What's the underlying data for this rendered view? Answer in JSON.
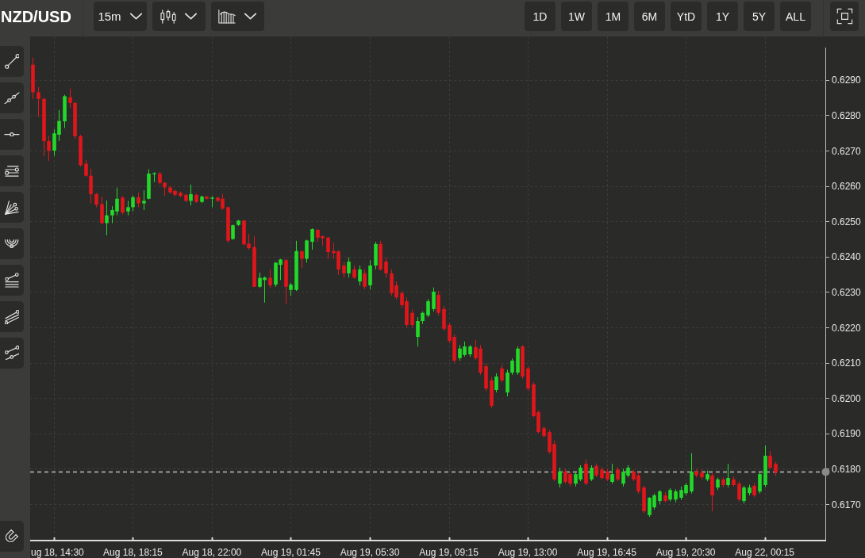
{
  "toolbar": {
    "symbol": "NZD/USD",
    "chart_controls": [
      {
        "kind": "interval",
        "label": "15m"
      },
      {
        "kind": "candles"
      },
      {
        "kind": "bars"
      }
    ],
    "ranges": [
      {
        "label": "1D",
        "selected": false
      },
      {
        "label": "1W",
        "selected": false
      },
      {
        "label": "1M",
        "selected": false
      },
      {
        "label": "6M",
        "selected": false
      },
      {
        "label": "YtD",
        "selected": false
      },
      {
        "label": "1Y",
        "selected": false
      },
      {
        "label": "5Y",
        "selected": false
      },
      {
        "label": "ALL",
        "selected": false
      }
    ]
  },
  "tools": [
    {
      "kind": "segment"
    },
    {
      "kind": "ray"
    },
    {
      "kind": "horizontal"
    },
    {
      "kind": "levels"
    },
    {
      "kind": "fan"
    },
    {
      "kind": "arcs"
    },
    {
      "kind": "angle_levels"
    },
    {
      "kind": "channel"
    },
    {
      "kind": "split"
    },
    {
      "kind": "magnet"
    }
  ],
  "chart": {
    "chart_data": {
      "type": "candlestick",
      "grid": true,
      "ylim": [
        0.61597,
        0.63023
      ],
      "yticks": [
        {
          "value": 0.629,
          "label": "0.6290"
        },
        {
          "value": 0.628,
          "label": "0.6280"
        },
        {
          "value": 0.627,
          "label": "0.6270"
        },
        {
          "value": 0.626,
          "label": "0.6260"
        },
        {
          "value": 0.625,
          "label": "0.6250"
        },
        {
          "value": 0.624,
          "label": "0.6240"
        },
        {
          "value": 0.623,
          "label": "0.6230"
        },
        {
          "value": 0.622,
          "label": "0.6220"
        },
        {
          "value": 0.621,
          "label": "0.6210"
        },
        {
          "value": 0.62,
          "label": "0.6200"
        },
        {
          "value": 0.619,
          "label": "0.6190"
        },
        {
          "value": 0.618,
          "label": "0.6180"
        },
        {
          "value": 0.617,
          "label": "0.6170"
        }
      ],
      "ref_lines": [
        {
          "axis": "y",
          "value": 0.61792
        }
      ],
      "categories": [
        null,
        null,
        null,
        null,
        "ug 18, 14:30",
        null,
        null,
        null,
        null,
        null,
        null,
        null,
        null,
        null,
        null,
        null,
        null,
        null,
        null,
        "Aug 18, 18:15",
        null,
        null,
        null,
        null,
        null,
        null,
        null,
        null,
        null,
        null,
        null,
        null,
        null,
        null,
        "Aug 18, 22:00",
        null,
        null,
        null,
        null,
        null,
        null,
        null,
        null,
        null,
        null,
        null,
        null,
        null,
        null,
        "Aug 19, 01:45",
        null,
        null,
        null,
        null,
        null,
        null,
        null,
        null,
        null,
        null,
        null,
        null,
        null,
        null,
        "Aug 19, 05:30",
        null,
        null,
        null,
        null,
        null,
        null,
        null,
        null,
        null,
        null,
        null,
        null,
        null,
        null,
        "Aug 19, 09:15",
        null,
        null,
        null,
        null,
        null,
        null,
        null,
        null,
        null,
        null,
        null,
        null,
        null,
        null,
        "Aug 19, 13:00",
        null,
        null,
        null,
        null,
        null,
        null,
        null,
        null,
        null,
        null,
        null,
        null,
        null,
        null,
        "Aug 19, 16:45",
        null,
        null,
        null,
        null,
        null,
        null,
        null,
        null,
        null,
        null,
        null,
        null,
        null,
        null,
        "Aug 19, 20:30",
        null,
        null,
        null,
        null,
        null,
        null,
        null,
        null,
        null,
        null,
        null,
        null,
        null,
        null,
        "Aug 22, 00:15",
        null,
        null,
        null,
        null,
        null,
        null,
        null,
        null,
        null,
        null,
        null
      ],
      "ohlc": [
        [
          0.62943,
          0.62963,
          0.62846,
          0.62865
        ],
        [
          0.62865,
          0.6288,
          0.62795,
          0.62846
        ],
        [
          0.62846,
          0.6285,
          0.62685,
          0.62727
        ],
        [
          0.62727,
          0.62741,
          0.62671,
          0.627
        ],
        [
          0.627,
          0.6276,
          0.62685,
          0.62749
        ],
        [
          0.62745,
          0.62815,
          0.62727,
          0.62784
        ],
        [
          0.62783,
          0.62858,
          0.62764,
          0.62854
        ],
        [
          0.62851,
          0.62876,
          0.6282,
          0.62835
        ],
        [
          0.62835,
          0.62838,
          0.62734,
          0.62741
        ],
        [
          0.62741,
          0.62745,
          0.62655,
          0.62659
        ],
        [
          0.62663,
          0.62674,
          0.62626,
          0.62629
        ],
        [
          0.62629,
          0.62649,
          0.62551,
          0.62577
        ],
        [
          0.62577,
          0.6258,
          0.6254,
          0.62547
        ],
        [
          0.62549,
          0.6257,
          0.62491,
          0.62495
        ],
        [
          0.62495,
          0.62559,
          0.62461,
          0.62517
        ],
        [
          0.62517,
          0.62543,
          0.62495,
          0.62532
        ],
        [
          0.62528,
          0.62595,
          0.62517,
          0.62564
        ],
        [
          0.62567,
          0.62572,
          0.6252,
          0.62525
        ],
        [
          0.62528,
          0.62558,
          0.62517,
          0.6254
        ],
        [
          0.6254,
          0.62573,
          0.62528,
          0.62568
        ],
        [
          0.62568,
          0.62581,
          0.6254,
          0.62551
        ],
        [
          0.62551,
          0.62588,
          0.62532,
          0.62558
        ],
        [
          0.62564,
          0.62647,
          0.62562,
          0.62635
        ],
        [
          0.62633,
          0.62639,
          0.62611,
          0.62636
        ],
        [
          0.62635,
          0.6264,
          0.62605,
          0.62609
        ],
        [
          0.62609,
          0.62612,
          0.62572,
          0.62596
        ],
        [
          0.62596,
          0.626,
          0.62578,
          0.62582
        ],
        [
          0.62586,
          0.6259,
          0.62571,
          0.62575
        ],
        [
          0.62581,
          0.62584,
          0.62568,
          0.62572
        ],
        [
          0.62575,
          0.62578,
          0.62555,
          0.62558
        ],
        [
          0.62558,
          0.62604,
          0.62545,
          0.62577
        ],
        [
          0.62575,
          0.62578,
          0.62552,
          0.62555
        ],
        [
          0.62555,
          0.62573,
          0.62552,
          0.6257
        ],
        [
          0.6257,
          0.62572,
          0.62562,
          0.62564
        ],
        [
          0.62564,
          0.62571,
          0.6254,
          0.62567
        ],
        [
          0.62567,
          0.6257,
          0.62555,
          0.62558
        ],
        [
          0.62564,
          0.62577,
          0.62533,
          0.62536
        ],
        [
          0.6254,
          0.62542,
          0.6244,
          0.62445
        ],
        [
          0.6245,
          0.62491,
          0.62448,
          0.62489
        ],
        [
          0.6249,
          0.62504,
          0.62487,
          0.62502
        ],
        [
          0.62502,
          0.62505,
          0.62432,
          0.62435
        ],
        [
          0.62437,
          0.62465,
          0.6242,
          0.62424
        ],
        [
          0.62427,
          0.62457,
          0.62314,
          0.62315
        ],
        [
          0.62315,
          0.62355,
          0.62312,
          0.6234
        ],
        [
          0.62334,
          0.62344,
          0.6227,
          0.62341
        ],
        [
          0.6234,
          0.62364,
          0.62312,
          0.62319
        ],
        [
          0.62321,
          0.62385,
          0.62315,
          0.62383
        ],
        [
          0.62377,
          0.62394,
          0.62334,
          0.62392
        ],
        [
          0.6239,
          0.62394,
          0.62267,
          0.62315
        ],
        [
          0.62306,
          0.62326,
          0.62289,
          0.62321
        ],
        [
          0.62306,
          0.62445,
          0.62303,
          0.62416
        ],
        [
          0.62415,
          0.62418,
          0.62368,
          0.62394
        ],
        [
          0.62394,
          0.62448,
          0.62383,
          0.62446
        ],
        [
          0.62442,
          0.6248,
          0.6242,
          0.62478
        ],
        [
          0.62476,
          0.62478,
          0.62442,
          0.62454
        ],
        [
          0.62458,
          0.6246,
          0.62431,
          0.62452
        ],
        [
          0.62454,
          0.62456,
          0.62394,
          0.62413
        ],
        [
          0.62416,
          0.62439,
          0.62394,
          0.6241
        ],
        [
          0.62415,
          0.62418,
          0.62349,
          0.62364
        ],
        [
          0.62375,
          0.62386,
          0.62341,
          0.62353
        ],
        [
          0.62353,
          0.62398,
          0.62341,
          0.62386
        ],
        [
          0.62364,
          0.62375,
          0.62337,
          0.62341
        ],
        [
          0.6233,
          0.62375,
          0.62319,
          0.62364
        ],
        [
          0.62353,
          0.62364,
          0.62308,
          0.62315
        ],
        [
          0.62319,
          0.6239,
          0.62308,
          0.62375
        ],
        [
          0.62375,
          0.62442,
          0.62364,
          0.62436
        ],
        [
          0.62436,
          0.62445,
          0.6236,
          0.62364
        ],
        [
          0.62386,
          0.62398,
          0.62341,
          0.62353
        ],
        [
          0.62353,
          0.62364,
          0.6229,
          0.62297
        ],
        [
          0.62319,
          0.6233,
          0.62279,
          0.62285
        ],
        [
          0.62297,
          0.62304,
          0.62255,
          0.62263
        ],
        [
          0.62274,
          0.62285,
          0.622,
          0.62207
        ],
        [
          0.62241,
          0.6225,
          0.622,
          0.62207
        ],
        [
          0.62173,
          0.62229,
          0.62146,
          0.62218
        ],
        [
          0.62218,
          0.62245,
          0.6221,
          0.62241
        ],
        [
          0.62234,
          0.6228,
          0.62229,
          0.62274
        ],
        [
          0.62252,
          0.62313,
          0.62245,
          0.62301
        ],
        [
          0.62292,
          0.62304,
          0.62234,
          0.62241
        ],
        [
          0.62252,
          0.6226,
          0.6219,
          0.62196
        ],
        [
          0.62207,
          0.62212,
          0.62155,
          0.62162
        ],
        [
          0.62173,
          0.6218,
          0.621,
          0.62106
        ],
        [
          0.62113,
          0.6215,
          0.62106,
          0.6214
        ],
        [
          0.62122,
          0.6216,
          0.62117,
          0.62146
        ],
        [
          0.62124,
          0.6215,
          0.62117,
          0.62146
        ],
        [
          0.62144,
          0.62165,
          0.62108,
          0.62113
        ],
        [
          0.6214,
          0.6215,
          0.62066,
          0.62072
        ],
        [
          0.6209,
          0.62098,
          0.6202,
          0.62027
        ],
        [
          0.6205,
          0.6206,
          0.61972,
          0.61978
        ],
        [
          0.62023,
          0.6207,
          0.62016,
          0.62061
        ],
        [
          0.62084,
          0.62095,
          0.62045,
          0.6205
        ],
        [
          0.62016,
          0.6208,
          0.62005,
          0.62072
        ],
        [
          0.62072,
          0.62112,
          0.62066,
          0.62106
        ],
        [
          0.62072,
          0.62146,
          0.62066,
          0.6214
        ],
        [
          0.62146,
          0.6215,
          0.62055,
          0.62061
        ],
        [
          0.62084,
          0.6209,
          0.6202,
          0.62027
        ],
        [
          0.62039,
          0.62045,
          0.61945,
          0.61949
        ],
        [
          0.6196,
          0.61965,
          0.619,
          0.61904
        ],
        [
          0.61915,
          0.6192,
          0.61888,
          0.61893
        ],
        [
          0.61904,
          0.6191,
          0.61842,
          0.61848
        ],
        [
          0.6187,
          0.6188,
          0.61765,
          0.6177
        ],
        [
          0.61758,
          0.61803,
          0.61747,
          0.61792
        ],
        [
          0.61792,
          0.618,
          0.61758,
          0.61763
        ],
        [
          0.61785,
          0.6179,
          0.6175,
          0.61758
        ],
        [
          0.61758,
          0.6179,
          0.6175,
          0.61785
        ],
        [
          0.6177,
          0.6181,
          0.61765,
          0.61803
        ],
        [
          0.61814,
          0.61826,
          0.61754,
          0.61758
        ],
        [
          0.6177,
          0.6181,
          0.61765,
          0.61803
        ],
        [
          0.61808,
          0.61815,
          0.61776,
          0.61781
        ],
        [
          0.61798,
          0.61805,
          0.6177,
          0.61774
        ],
        [
          0.61792,
          0.618,
          0.61765,
          0.6177
        ],
        [
          0.61763,
          0.61814,
          0.61758,
          0.61785
        ],
        [
          0.61798,
          0.61805,
          0.61765,
          0.6177
        ],
        [
          0.61758,
          0.618,
          0.6175,
          0.61792
        ],
        [
          0.61781,
          0.6181,
          0.61776,
          0.61803
        ],
        [
          0.61792,
          0.61798,
          0.61765,
          0.6177
        ],
        [
          0.61781,
          0.6179,
          0.6173,
          0.61736
        ],
        [
          0.61747,
          0.61752,
          0.61675,
          0.6168
        ],
        [
          0.61669,
          0.6172,
          0.61664,
          0.61718
        ],
        [
          0.61691,
          0.6173,
          0.61685,
          0.61725
        ],
        [
          0.61709,
          0.6174,
          0.617,
          0.61736
        ],
        [
          0.61725,
          0.61735,
          0.61705,
          0.61709
        ],
        [
          0.61713,
          0.61745,
          0.61708,
          0.6174
        ],
        [
          0.61713,
          0.61742,
          0.61705,
          0.61736
        ],
        [
          0.61718,
          0.6175,
          0.61712,
          0.6174
        ],
        [
          0.61731,
          0.6176,
          0.61725,
          0.61754
        ],
        [
          0.61736,
          0.61844,
          0.6173,
          0.61792
        ],
        [
          0.61792,
          0.618,
          0.61775,
          0.61781
        ],
        [
          0.61789,
          0.61798,
          0.6177,
          0.61776
        ],
        [
          0.6177,
          0.61795,
          0.61765,
          0.61785
        ],
        [
          0.61781,
          0.6179,
          0.6168,
          0.61725
        ],
        [
          0.61747,
          0.61775,
          0.6174,
          0.6177
        ],
        [
          0.6177,
          0.61776,
          0.61748,
          0.61754
        ],
        [
          0.61754,
          0.61814,
          0.61748,
          0.61774
        ],
        [
          0.6177,
          0.61778,
          0.6175,
          0.61754
        ],
        [
          0.61758,
          0.61764,
          0.61708,
          0.61713
        ],
        [
          0.61709,
          0.61752,
          0.61702,
          0.61747
        ],
        [
          0.61731,
          0.61755,
          0.61725,
          0.61747
        ],
        [
          0.61752,
          0.6176,
          0.6172,
          0.61725
        ],
        [
          0.61736,
          0.6179,
          0.6173,
          0.61785
        ],
        [
          0.61754,
          0.61866,
          0.61748,
          0.61837
        ],
        [
          0.61837,
          0.6185,
          0.618,
          0.61803
        ],
        [
          0.61814,
          0.6182,
          0.6178,
          0.6179
        ],
        null,
        null,
        null,
        null,
        null,
        null,
        null,
        null,
        null
      ]
    }
  }
}
